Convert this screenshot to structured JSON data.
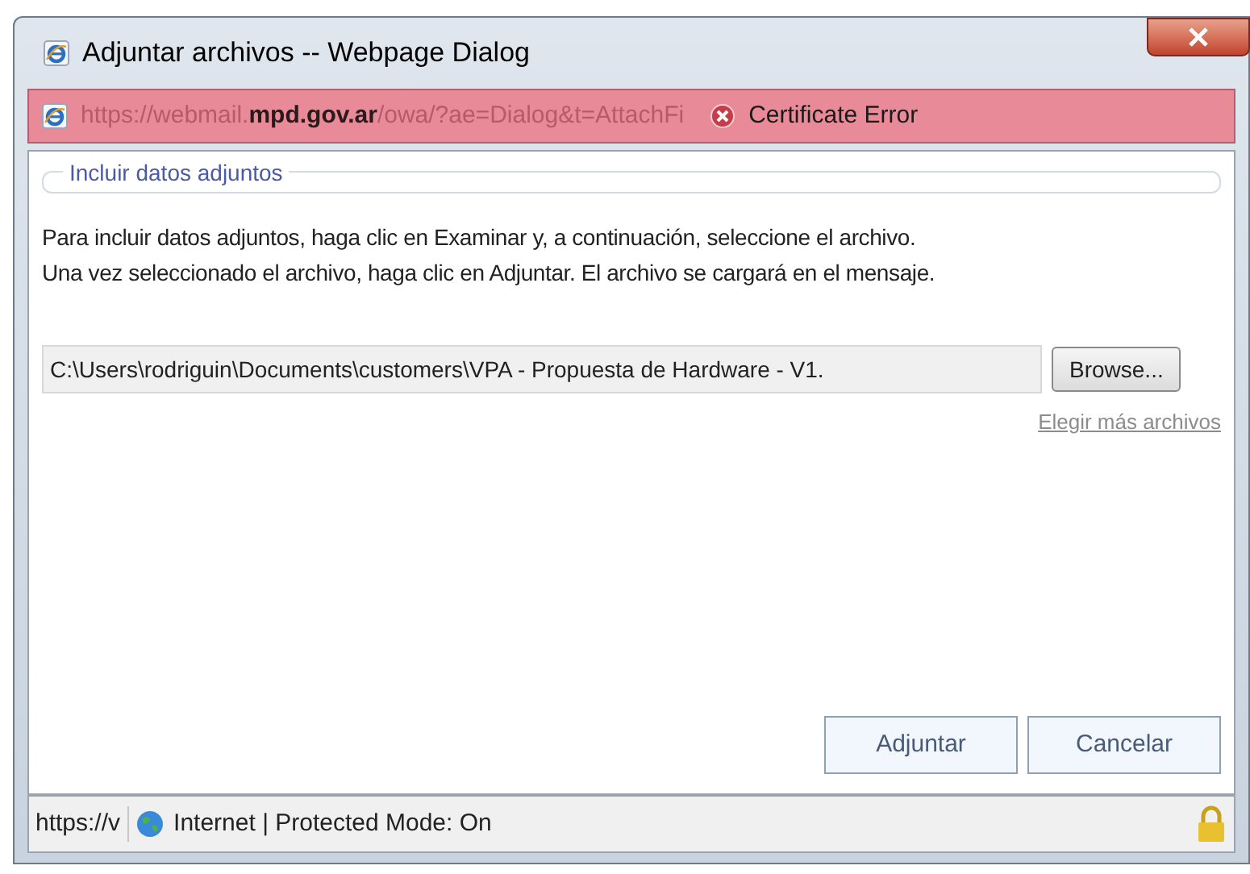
{
  "window": {
    "title": "Adjuntar archivos -- Webpage Dialog"
  },
  "address_bar": {
    "url": "https://webmail.**mpd.gov.ar**/owa/?ae=Dialog&t=AttachFi",
    "certificate": "Certificate Error"
  },
  "group": {
    "legend": "Incluir datos adjuntos"
  },
  "instructions": [
    "Para incluir datos adjuntos, haga clic en Examinar y, a continuación, seleccione el archivo.",
    "Una vez seleccionado el archivo, haga clic en Adjuntar. El archivo se cargará en el mensaje."
  ],
  "file_field": {
    "value": "C:\\Users\\rodriguin\\Documents\\customers\\VPA - Propuesta de Hardware - V1.",
    "browse": "Browse..."
  },
  "more_link": "Elegir más archivos",
  "buttons": [
    "Adjuntar",
    "Cancelar"
  ],
  "status_bar": {
    "url": "https://v",
    "zone": "Internet | Protected Mode: On"
  }
}
